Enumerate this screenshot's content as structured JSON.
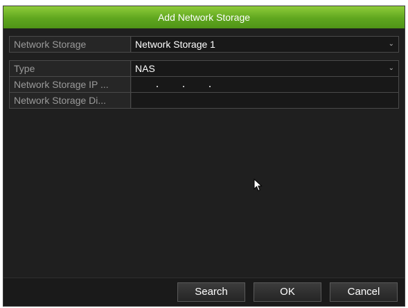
{
  "dialog": {
    "title": "Add Network Storage"
  },
  "storage_select": {
    "label": "Network Storage",
    "value": "Network Storage 1"
  },
  "type_select": {
    "label": "Type",
    "value": "NAS"
  },
  "ip_field": {
    "label": "Network Storage IP ...",
    "value": ""
  },
  "directory_field": {
    "label": "Network Storage Di...",
    "value": ""
  },
  "buttons": {
    "search": "Search",
    "ok": "OK",
    "cancel": "Cancel"
  },
  "colors": {
    "title_green": "#6cb224",
    "panel_bg": "#1f1f1f"
  },
  "icons": [
    "chevron-down-icon",
    "mouse-pointer-icon"
  ]
}
